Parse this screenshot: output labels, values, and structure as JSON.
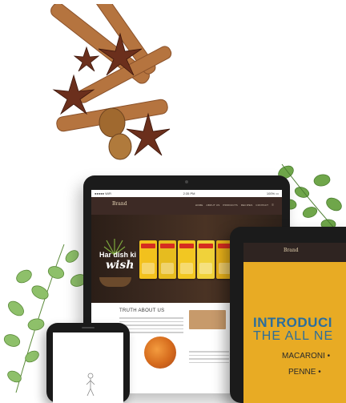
{
  "tablet": {
    "status_carrier": "●●●●● WiFi",
    "status_time": "2:35 PM",
    "status_battery": "100% ▭",
    "logo": "Brand",
    "nav": [
      "HOME",
      "ABOUT US",
      "PRODUCTS",
      "RECIPES",
      "CONTACT",
      "☰"
    ],
    "hero_line1": "Har dish ki",
    "hero_line2": "wish",
    "about_title": "TRUTH ABOUT US"
  },
  "tablet2": {
    "logo": "Brand",
    "headline": "INTRODUCI",
    "subheadline": "THE ALL NE",
    "item1": "MACARONI  •",
    "item2": "PENNE  •"
  },
  "colors": {
    "header_brown": "#3d2a25",
    "promo_yellow": "#e8ab24",
    "headline_blue": "#2c6e9b",
    "pack_colors": [
      "#f2c11d",
      "#e6bc1f",
      "#f2c722",
      "#f0d23a",
      "#e9b21a",
      "#f0c428"
    ]
  }
}
